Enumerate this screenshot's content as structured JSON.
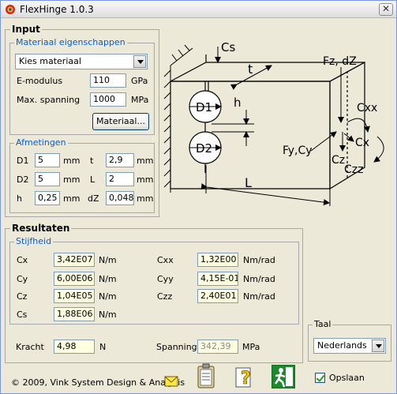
{
  "window": {
    "title": "FlexHinge 1.0.3",
    "close": "✕"
  },
  "input": {
    "title": "Input",
    "materials": {
      "title": "Materiaal eigenschappen",
      "selected": "Kies materiaal",
      "emodulus_label": "E-modulus",
      "emodulus_value": "110",
      "emodulus_unit": "GPa",
      "spanning_label": "Max. spanning",
      "spanning_value": "1000",
      "spanning_unit": "MPa",
      "button": "Materiaal..."
    },
    "dims": {
      "title": "Afmetingen",
      "D1_label": "D1",
      "D1_value": "5",
      "D1_unit": "mm",
      "D2_label": "D2",
      "D2_value": "5",
      "D2_unit": "mm",
      "h_label": "h",
      "h_value": "0,25",
      "h_unit": "mm",
      "t_label": "t",
      "t_value": "2,9",
      "t_unit": "mm",
      "L_label": "L",
      "L_value": "2",
      "L_unit": "mm",
      "dZ_label": "dZ",
      "dZ_value": "0,048",
      "dZ_unit": "mm"
    }
  },
  "diagram": {
    "Cs": "Cs",
    "t": "t",
    "h": "h",
    "D1": "D1",
    "D2": "D2",
    "L": "L",
    "Fz": "Fz, dZ",
    "Cxx": "Cxx",
    "Cx": "Cx",
    "Cz": "Cz",
    "Czz": "Czz",
    "Fy": "Fy,Cy"
  },
  "results": {
    "title": "Resultaten",
    "stiff_title": "Stijfheid",
    "Cx_label": "Cx",
    "Cx_value": "3,42E07",
    "Cx_unit": "N/m",
    "Cy_label": "Cy",
    "Cy_value": "6,00E06",
    "Cy_unit": "N/m",
    "Cz_label": "Cz",
    "Cz_value": "1,04E05",
    "Cz_unit": "N/m",
    "Cs_label": "Cs",
    "Cs_value": "1,88E06",
    "Cs_unit": "N/m",
    "Cxx_label": "Cxx",
    "Cxx_value": "1,32E00",
    "Cxx_unit": "Nm/rad",
    "Cyy_label": "Cyy",
    "Cyy_value": "4,15E-01",
    "Cyy_unit": "Nm/rad",
    "Czz_label": "Czz",
    "Czz_value": "2,40E01",
    "Czz_unit": "Nm/rad",
    "kracht_label": "Kracht",
    "kracht_value": "4,98",
    "kracht_unit": "N",
    "spanning_label": "Spanning",
    "spanning_value": "342,39",
    "spanning_unit": "MPa"
  },
  "taal": {
    "title": "Taal",
    "selected": "Nederlands"
  },
  "footer": {
    "copyright": "© 2009, Vink System Design & Analysis",
    "save_label": "Opslaan",
    "icons": [
      "mail-icon",
      "clipboard-icon",
      "help-icon",
      "exit-icon"
    ]
  }
}
